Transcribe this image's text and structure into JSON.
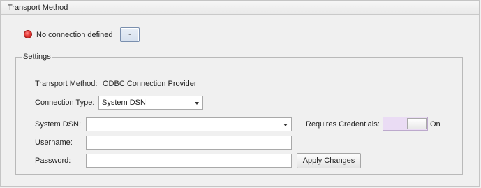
{
  "panel": {
    "title": "Transport Method"
  },
  "connection": {
    "status_text": "No connection defined",
    "status_color": "#e53935",
    "action_label": "-"
  },
  "settings": {
    "legend": "Settings",
    "transport_method_label": "Transport Method:",
    "transport_method_value": "ODBC Connection Provider",
    "connection_type_label": "Connection Type:",
    "connection_type_value": "System DSN",
    "system_dsn_label": "System DSN:",
    "system_dsn_value": "",
    "requires_credentials_label": "Requires Credentials:",
    "requires_credentials_state": "On",
    "username_label": "Username:",
    "username_value": "",
    "password_label": "Password:",
    "password_value": "",
    "apply_label": "Apply Changes"
  },
  "colors": {
    "toggle_track": "#eadcf4"
  }
}
